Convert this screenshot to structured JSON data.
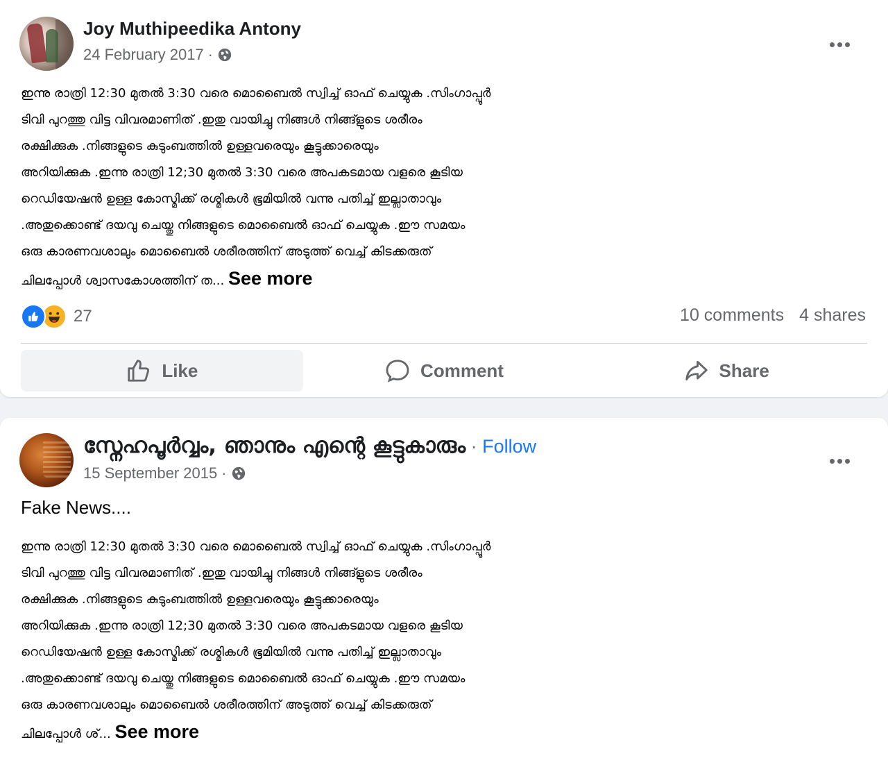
{
  "posts": [
    {
      "author": "Joy Muthipeedika Antony",
      "date": "24 February 2017",
      "meta_separator": "·",
      "privacy_icon": "globe-icon",
      "more_icon": "more-options-icon",
      "body_lines": [
        "ഇന്നു രാത്രി 12:30 മുതൽ 3:30 വരെ മൊബൈൽ സ്വിച്ച് ഓഫ് ചെയ്യുക .സിംഗാപ്പൂർ",
        "ടിവി പുറത്തു വിട്ട വിവരമാണിത് .ഇതു വായിച്ചു നിങ്ങൾ നിങ്ങ്ളുടെ ശരീരം",
        "രക്ഷിക്കുക .നിങ്ങളുടെ കുടുംബത്തിൽ ഉള്ളവരെയും കൂട്ടുക്കാരെയും",
        "അറിയിക്കുക .ഇന്നു രാത്രി 12;30 മുതൽ 3:30 വരെ അപകടമായ വളരെ കൂടിയ",
        "റെഡിയേഷൻ ഉള്ള കോസ്മിക്ക് രശ്മികൾ ഭൂമിയിൽ വന്നു പതിച്ച് ഇല്ലാതാവും",
        ".അതുക്കൊണ്ട് ദയവു ചെയ്തു നിങ്ങളുടെ മൊബൈൽ ഓഫ് ചെയ്യുക  .ഈ സമയം",
        "ഒരു  കാരണവശാലും മൊബൈൽ ശരീരത്തിന് അടുത്ത് വെച്ച് കിടക്കരുത്"
      ],
      "last_line": "ചിലപ്പോൾ ശ്വാസകോശത്തിന് ത...",
      "see_more": "See more",
      "reaction_count": "27",
      "comments": "10 comments",
      "shares": "4 shares",
      "actions": {
        "like": "Like",
        "comment": "Comment",
        "share": "Share"
      }
    },
    {
      "author": "സ്നേഹപൂർവ്വം, ഞാനും എന്റെ കൂട്ടുകാരും",
      "follow_separator": "·",
      "follow": "Follow",
      "date": "15 September 2015",
      "meta_separator": "·",
      "privacy_icon": "globe-icon",
      "more_icon": "more-options-icon",
      "intro": "Fake News....",
      "body_lines": [
        "ഇന്നു രാത്രി 12:30 മുതൽ 3:30 വരെ മൊബൈൽ സ്വിച്ച് ഓഫ് ചെയ്യുക .സിംഗാപ്പൂർ",
        "ടിവി പുറത്തു വിട്ട വിവരമാണിത് .ഇതു വായിച്ചു നിങ്ങൾ നിങ്ങ്ളുടെ ശരീരം",
        "രക്ഷിക്കുക .നിങ്ങളുടെ കുടുംബത്തിൽ ഉള്ളവരെയും കൂട്ടുക്കാരെയും",
        "അറിയിക്കുക .ഇന്നു രാത്രി 12;30 മുതൽ 3:30 വരെ അപകടമായ വളരെ കൂടിയ",
        "റെഡിയേഷൻ ഉള്ള കോസ്മിക്ക് രശ്മികൾ ഭൂമിയിൽ വന്നു പതിച്ച് ഇല്ലാതാവും",
        ".അതുക്കൊണ്ട് ദയവു ചെയ്തു നിങ്ങളുടെ മൊബൈൽ ഓഫ് ചെയ്യുക .ഈ സമയം",
        "ഒരു കാരണവശാലും മൊബൈൽ ശരീരത്തിന് അടുത്ത് വെച്ച് കിടക്കരുത്"
      ],
      "last_line": "ചിലപ്പോൾ ശ്...",
      "see_more": "See more"
    }
  ],
  "colors": {
    "background": "#f0f2f5",
    "card": "#ffffff",
    "secondary_text": "#65676b",
    "follow_blue": "#1877f2",
    "like_blue": "#1877f2",
    "haha_yellow": "#f7b125"
  }
}
